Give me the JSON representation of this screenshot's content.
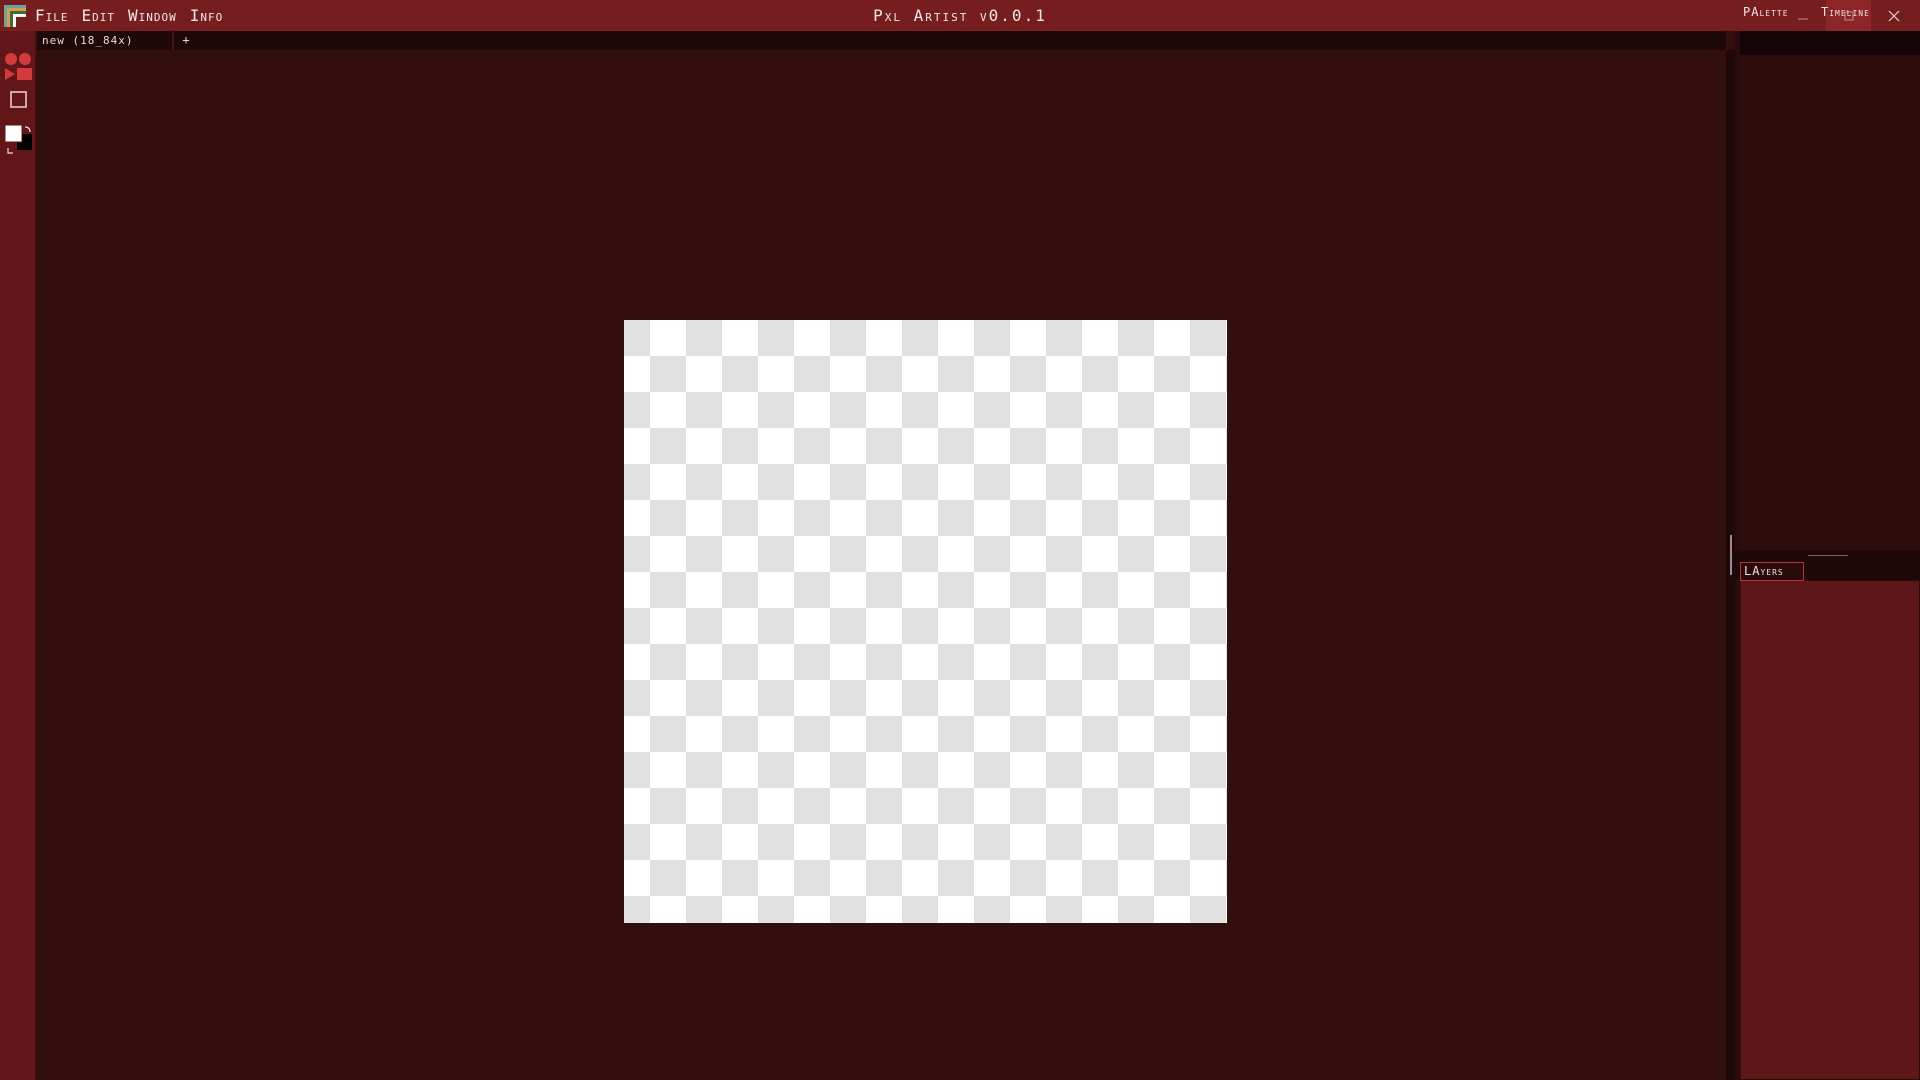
{
  "app": {
    "title": "Pxl Artist v0.0.1"
  },
  "menu": {
    "items": [
      "File",
      "Edit",
      "Window",
      "Info"
    ]
  },
  "document": {
    "tab_label": "new (18_84x)",
    "add_tab_label": "+"
  },
  "panels": {
    "palette_tab": "PAlette",
    "timeline_tab": "Timeline",
    "layers_tab": "LAyers"
  },
  "colors": {
    "titlebar": "#761e1f",
    "workspace": "#330e0f",
    "toolbar": "#621617",
    "accent": "#d23a3d",
    "primary_color": "#ffffff",
    "secondary_color": "#000000"
  },
  "icons": {
    "app_logo": "app-logo-icon",
    "shapes_tool": "shapes-tool-icon",
    "select_tool": "rectangle-select-icon",
    "swap_colors": "swap-colors-icon",
    "reset_colors": "reset-colors-icon",
    "minimize": "minimize-icon",
    "maximize": "maximize-icon",
    "close": "close-icon"
  }
}
